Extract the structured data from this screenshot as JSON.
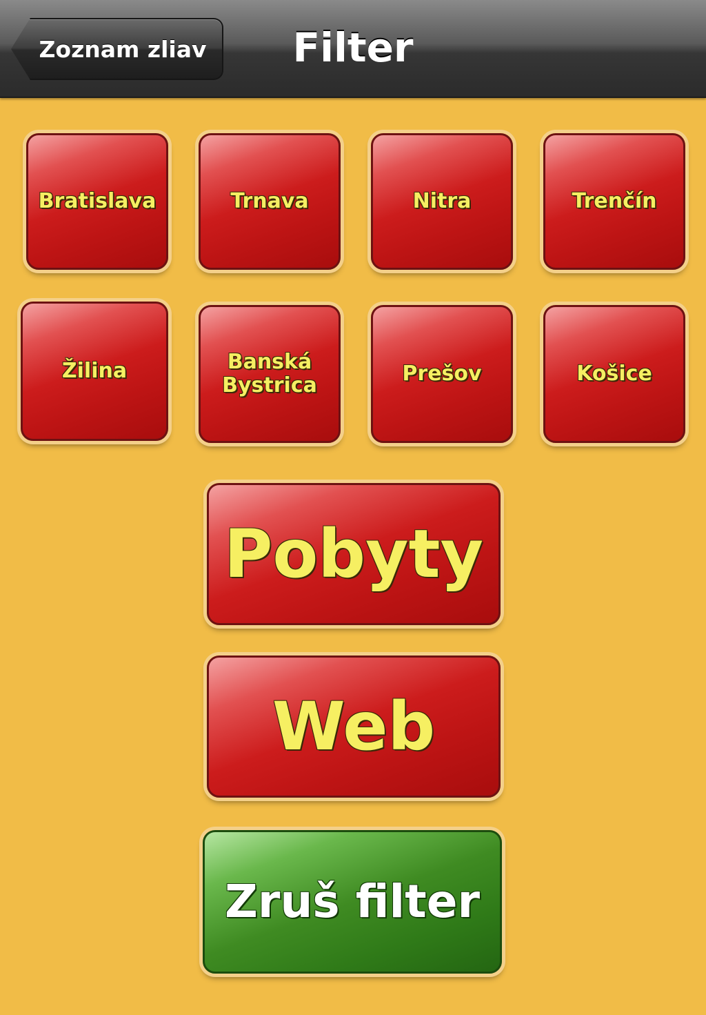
{
  "navbar": {
    "back_label": "Zoznam zliav",
    "title": "Filter"
  },
  "regions": [
    {
      "label": "Bratislava"
    },
    {
      "label": "Trnava"
    },
    {
      "label": "Nitra"
    },
    {
      "label": "Trenčín"
    },
    {
      "label": "Žilina"
    },
    {
      "label": "Banská\nBystrica"
    },
    {
      "label": "Prešov"
    },
    {
      "label": "Košice"
    }
  ],
  "actions": {
    "pobyty_label": "Pobyty",
    "web_label": "Web",
    "clear_label": "Zruš filter"
  },
  "colors": {
    "background": "#f1bc47",
    "button_red": "#cc1c1c",
    "button_green": "#3f8b22",
    "label_yellow": "#f6ef62"
  }
}
